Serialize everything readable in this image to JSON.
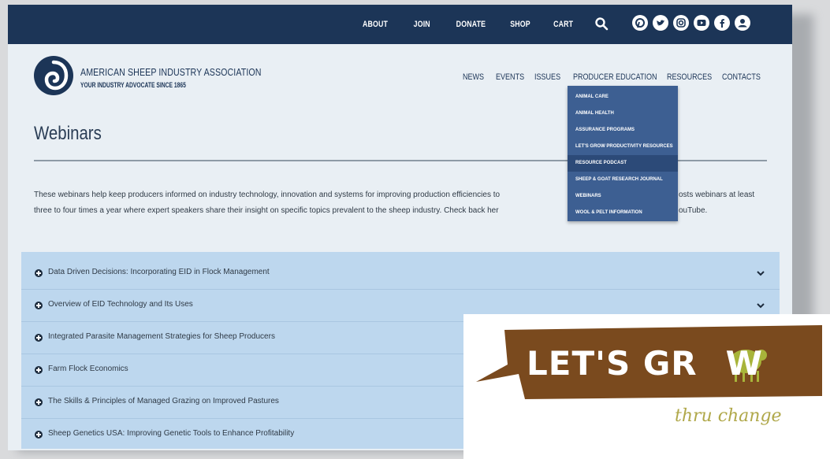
{
  "topbar": {
    "links": [
      "ABOUT",
      "JOIN",
      "DONATE",
      "SHOP",
      "CART"
    ],
    "search_icon": "search-icon",
    "social_icons": [
      "pinterest-icon",
      "twitter-icon",
      "instagram-icon",
      "youtube-icon",
      "facebook-icon",
      "user-icon"
    ],
    "bg_color": "#1c3557"
  },
  "header": {
    "org_name": "AMERICAN SHEEP INDUSTRY ASSOCIATION",
    "tagline": "YOUR INDUSTRY ADVOCATE SINCE 1865",
    "nav": [
      "NEWS",
      "EVENTS",
      "ISSUES",
      "PRODUCER EDUCATION",
      "RESOURCES",
      "CONTACTS"
    ]
  },
  "dropdown": {
    "items": [
      "ANIMAL CARE",
      "ANIMAL HEALTH",
      "ASSURANCE PROGRAMS",
      "LET'S GROW PRODUCTIVITY RESOURCES",
      "RESOURCE PODCAST",
      "SHEEP & GOAT RESEARCH JOURNAL",
      "WEBINARS",
      "WOOL & PELT INFORMATION"
    ]
  },
  "main": {
    "title": "Webinars",
    "intro_line1": "These webinars help keep producers informed on industry technology, innovation and systems for improving production efficiencies to",
    "intro_line1_end": "osts webinars at least",
    "intro_line2": "three to four times a year where expert speakers share their insight on specific topics prevalent to the sheep industry. Check back her",
    "intro_line2_end": "ouTube."
  },
  "accordion": {
    "items": [
      "Data Driven Decisions: Incorporating EID in Flock Management",
      "Overview of EID Technology and Its Uses",
      "Integrated Parasite Management Strategies for Sheep Producers",
      "Farm Flock Economics",
      "The Skills & Principles of Managed Grazing on Improved Pastures",
      "Sheep Genetics USA: Improving Genetic Tools to Enhance Profitability"
    ]
  },
  "promo": {
    "headline": "LET'S GR",
    "headline_end": "W",
    "script": "thru change",
    "brand_color": "#7a4a1e",
    "accent_color": "#a8b43a"
  }
}
